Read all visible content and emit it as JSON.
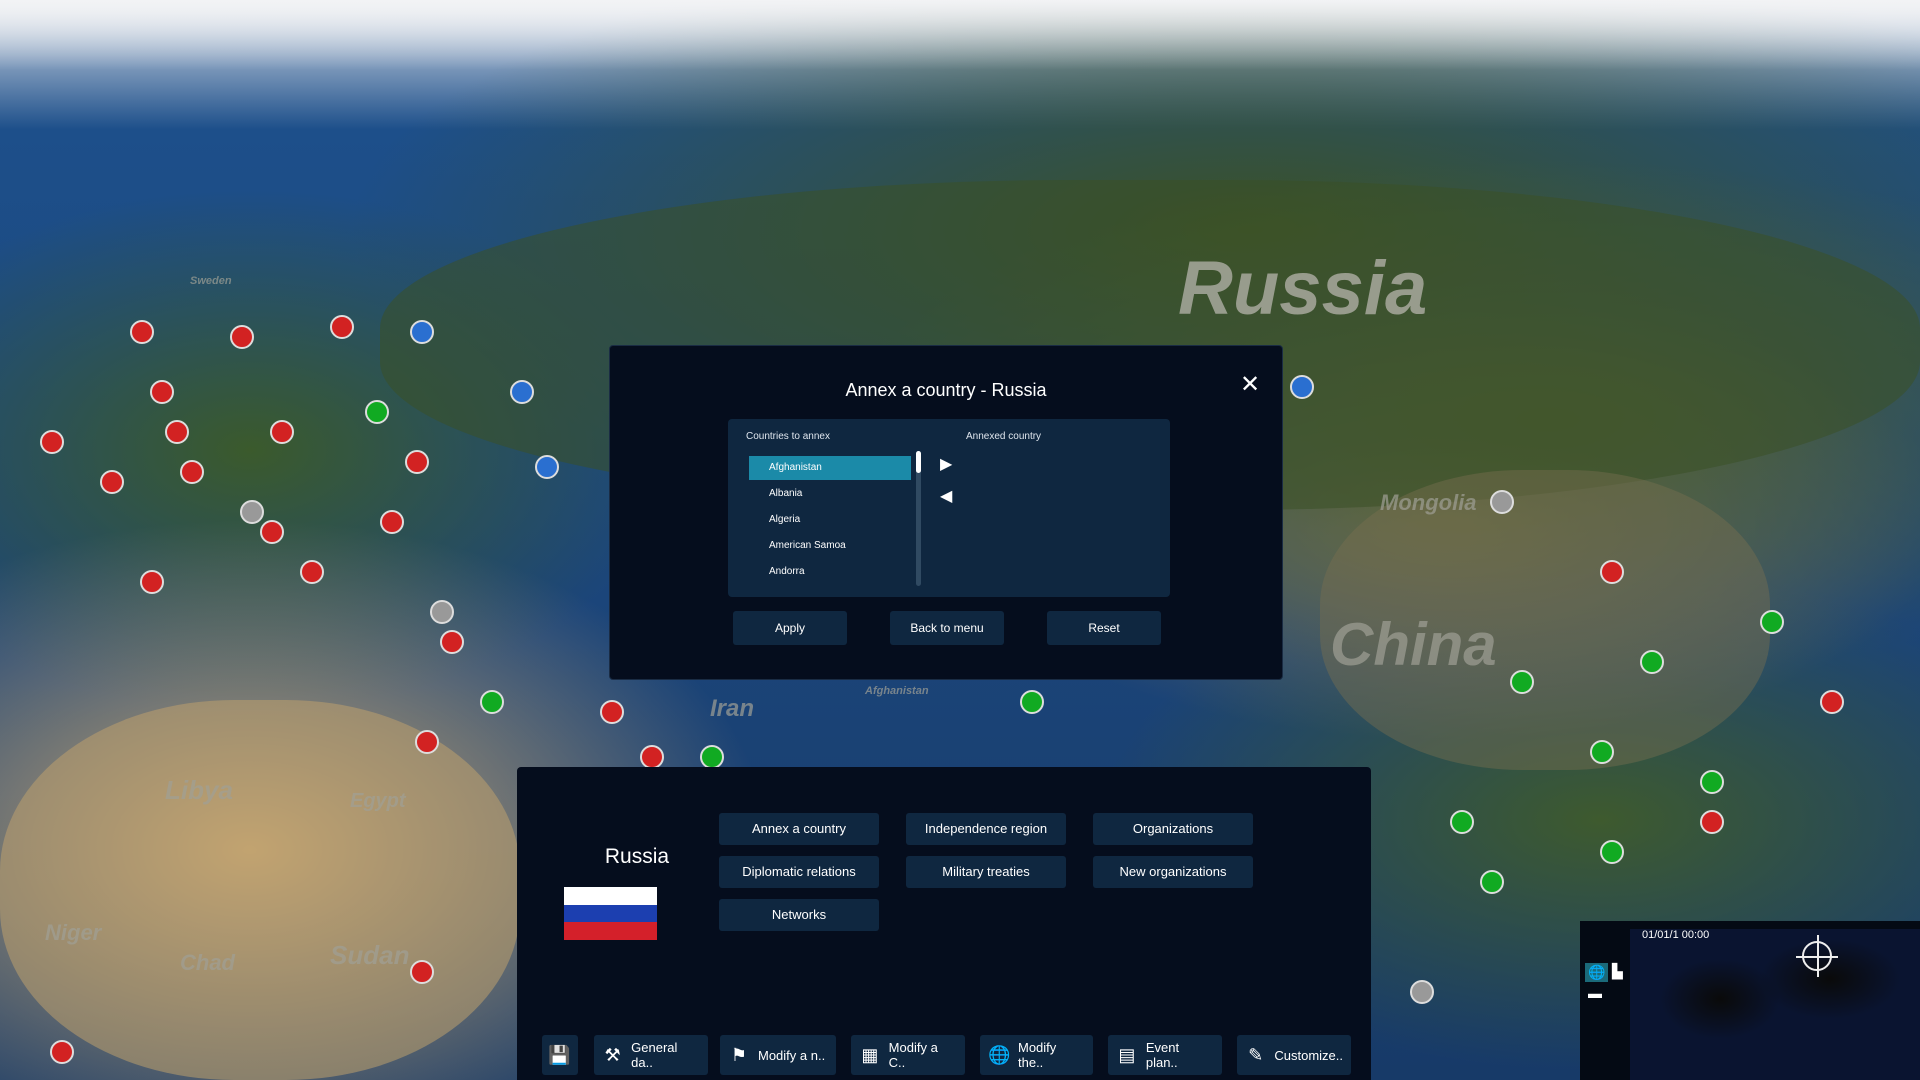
{
  "map": {
    "labels": {
      "russia": "Russia",
      "china": "China",
      "iran": "Iran",
      "libya": "Libya",
      "egypt": "Egypt",
      "niger": "Niger",
      "chad": "Chad",
      "sudan": "Sudan",
      "mongolia": "Mongolia",
      "sweden": "Sweden",
      "afghanistan": "Afghanistan"
    },
    "marker_colors": {
      "hostile": "#d22222",
      "allied": "#11aa22",
      "neutral": "#999999",
      "own": "#2a6fd0"
    }
  },
  "dialog": {
    "title": "Annex a country - Russia",
    "close_icon": "close-icon",
    "countries_header": "Countries to annex",
    "annexed_header": "Annexed country",
    "countries": [
      "Afghanistan",
      "Albania",
      "Algeria",
      "American Samoa",
      "Andorra"
    ],
    "selected": "Afghanistan",
    "add_icon": "arrow-right-icon",
    "remove_icon": "arrow-left-icon",
    "buttons": {
      "apply": "Apply",
      "back": "Back to menu",
      "reset": "Reset"
    },
    "accent": "#1b8aa8"
  },
  "country_panel": {
    "name": "Russia",
    "actions": [
      "Annex a country",
      "Independence region",
      "Organizations",
      "Diplomatic relations",
      "Military treaties",
      "New organizations",
      "Networks"
    ]
  },
  "toolbar": {
    "items": [
      {
        "icon": "save-icon",
        "label": ""
      },
      {
        "icon": "tools-icon",
        "label": "General da.."
      },
      {
        "icon": "flag-icon",
        "label": "Modify a n.."
      },
      {
        "icon": "building-icon",
        "label": "Modify a C.."
      },
      {
        "icon": "globe-icon",
        "label": "Modify the.."
      },
      {
        "icon": "calendar-icon",
        "label": "Event plan.."
      },
      {
        "icon": "user-edit-icon",
        "label": "Customize.."
      }
    ]
  },
  "minimap": {
    "datetime": "01/01/1 00:00"
  }
}
